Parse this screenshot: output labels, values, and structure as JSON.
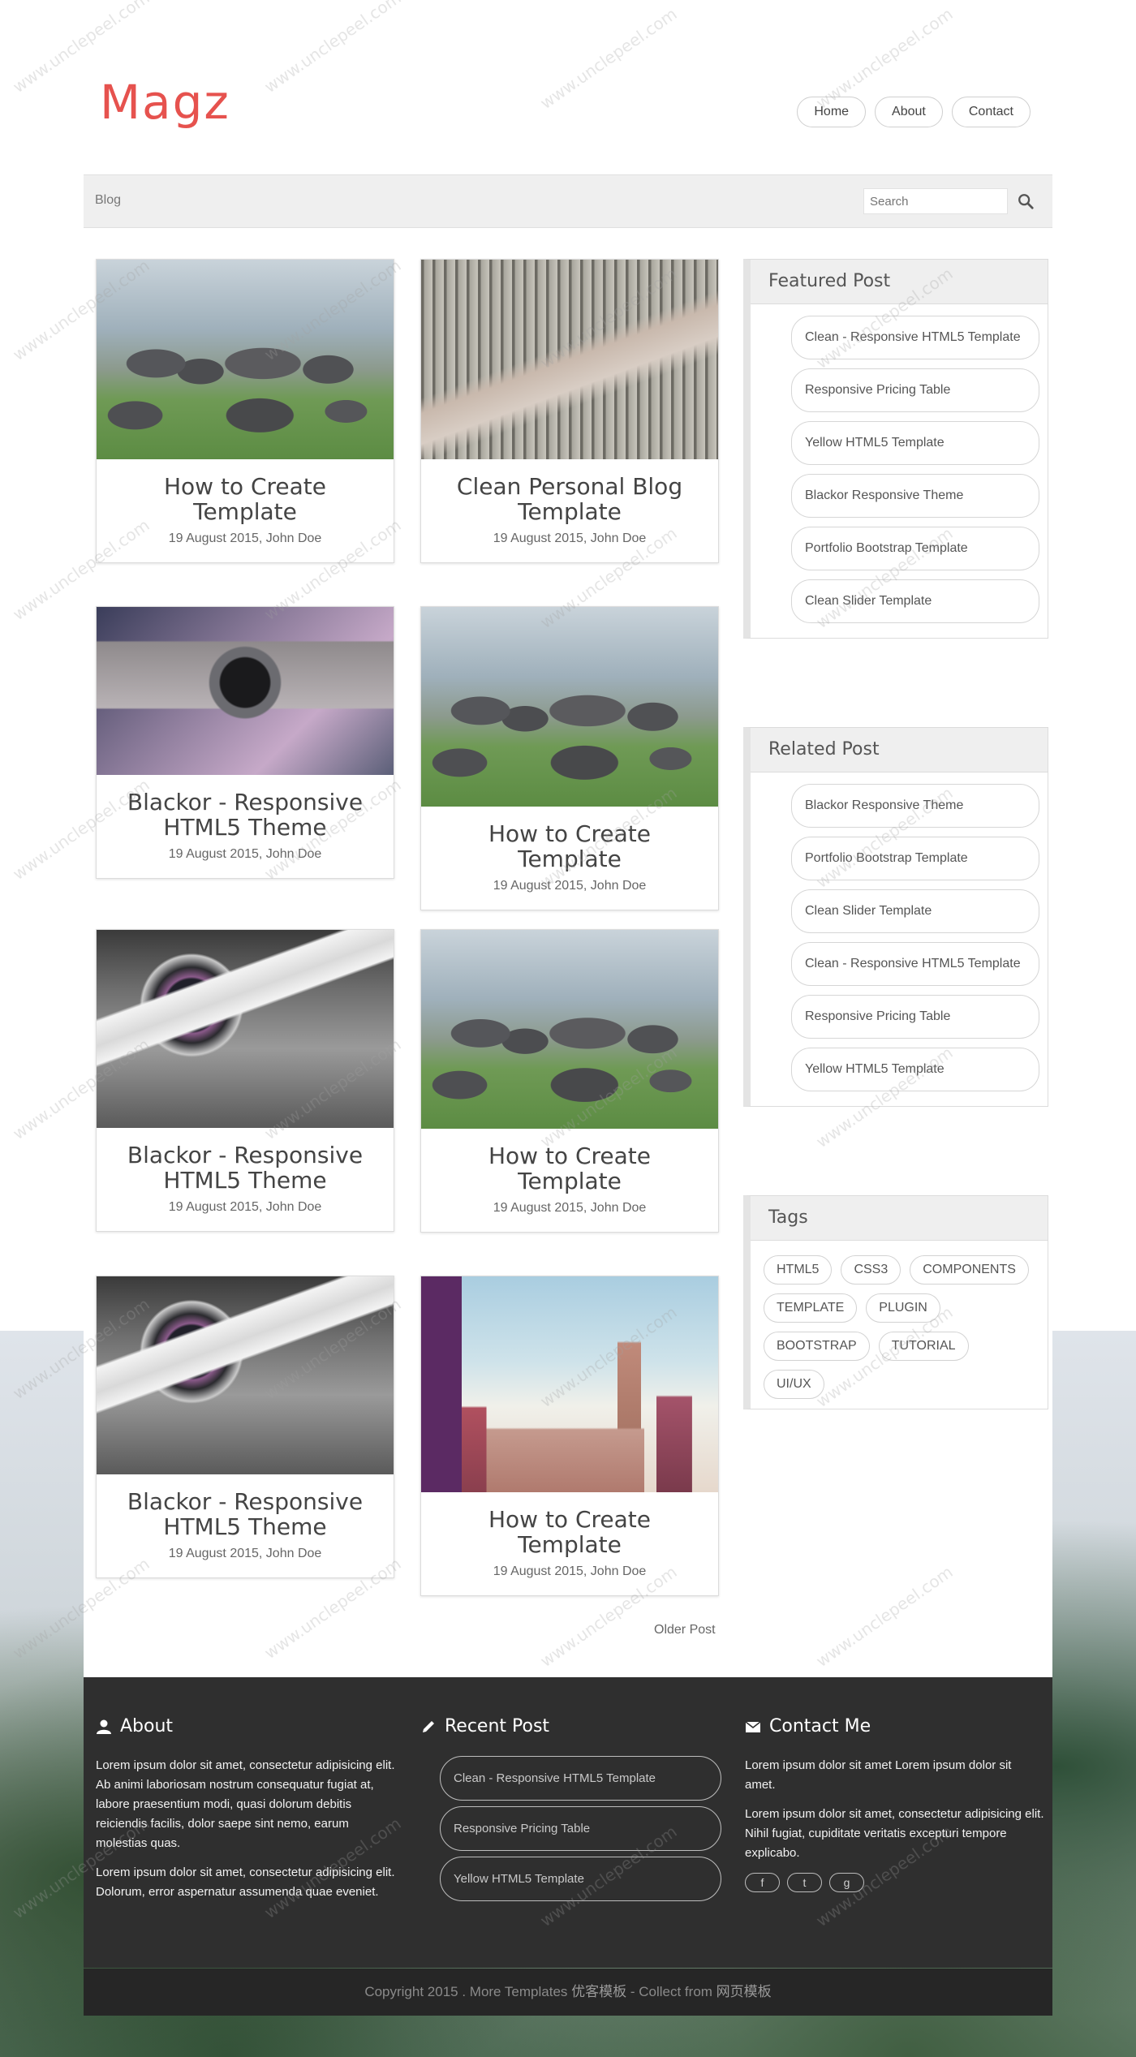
{
  "brand": {
    "logo": "Magz",
    "accent": "#e6524e"
  },
  "nav": {
    "home": "Home",
    "about": "About",
    "contact": "Contact"
  },
  "breadcrumb": {
    "current": "Blog"
  },
  "search": {
    "placeholder": "Search"
  },
  "posts": [
    {
      "title": "How to Create Template",
      "meta": "19 August 2015, John Doe",
      "image": "rocks"
    },
    {
      "title": "Clean Personal Blog Template",
      "meta": "19 August 2015, John Doe",
      "image": "road"
    },
    {
      "title": "Blackor - Responsive HTML5 Theme",
      "meta": "19 August 2015, John Doe",
      "image": "camera"
    },
    {
      "title": "How to Create Template",
      "meta": "19 August 2015, John Doe",
      "image": "rocks"
    },
    {
      "title": "Blackor - Responsive HTML5 Theme",
      "meta": "19 August 2015, John Doe",
      "image": "camera-bw"
    },
    {
      "title": "How to Create Template",
      "meta": "19 August 2015, John Doe",
      "image": "rocks"
    },
    {
      "title": "Blackor - Responsive HTML5 Theme",
      "meta": "19 August 2015, John Doe",
      "image": "camera-bw"
    },
    {
      "title": "How to Create Template",
      "meta": "19 August 2015, John Doe",
      "image": "city"
    }
  ],
  "pagination": {
    "older": "Older Post"
  },
  "featured": {
    "title": "Featured Post",
    "items": [
      "Clean - Responsive HTML5 Template",
      "Responsive Pricing Table",
      "Yellow HTML5 Template",
      "Blackor Responsive Theme",
      "Portfolio Bootstrap Template",
      "Clean Slider Template"
    ]
  },
  "related": {
    "title": "Related Post",
    "items": [
      "Blackor Responsive Theme",
      "Portfolio Bootstrap Template",
      "Clean Slider Template",
      "Clean - Responsive HTML5 Template",
      "Responsive Pricing Table",
      "Yellow HTML5 Template"
    ]
  },
  "tags": {
    "title": "Tags",
    "items": [
      "HTML5",
      "CSS3",
      "COMPONENTS",
      "TEMPLATE",
      "PLUGIN",
      "BOOTSTRAP",
      "TUTORIAL",
      "UI/UX"
    ]
  },
  "footer": {
    "about": {
      "title": "About",
      "p1": "Lorem ipsum dolor sit amet, consectetur adipisicing elit. Ab animi laboriosam nostrum consequatur fugiat at, labore praesentium modi, quasi dolorum debitis reiciendis facilis, dolor saepe sint nemo, earum molestias quas.",
      "p2": "Lorem ipsum dolor sit amet, consectetur adipisicing elit. Dolorum, error aspernatur assumenda quae eveniet."
    },
    "recent": {
      "title": "Recent Post",
      "items": [
        "Clean - Responsive HTML5 Template",
        "Responsive Pricing Table",
        "Yellow HTML5 Template"
      ]
    },
    "contact": {
      "title": "Contact Me",
      "p1": "Lorem ipsum dolor sit amet Lorem ipsum dolor sit amet.",
      "p2": "Lorem ipsum dolor sit amet, consectetur adipisicing elit. Nihil fugiat, cupiditate veritatis excepturi tempore explicabo.",
      "social": [
        "f",
        "t",
        "g"
      ]
    },
    "copyright": {
      "prefix": "Copyright 2015 . More Templates ",
      "cn1": "优客模板",
      "mid": " - Collect from ",
      "cn2": "网页模板"
    }
  },
  "watermark": "www.unclepeel.com"
}
